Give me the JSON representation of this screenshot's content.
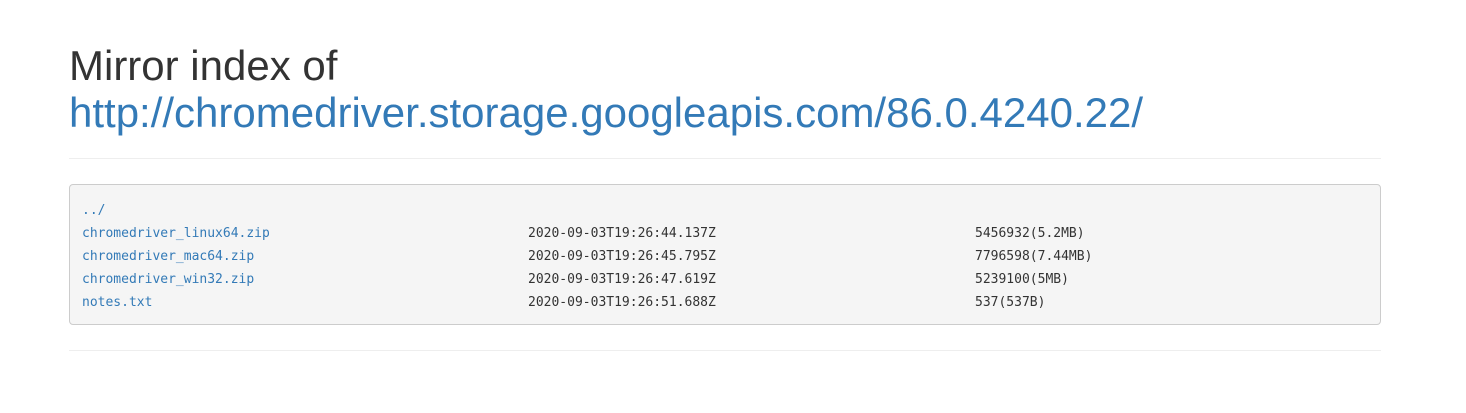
{
  "header": {
    "title_prefix": "Mirror index of",
    "title_url": "http://chromedriver.storage.googleapis.com/86.0.4240.22/"
  },
  "listing": {
    "parent_link": "../",
    "files": [
      {
        "name": "chromedriver_linux64.zip",
        "modified": "2020-09-03T19:26:44.137Z",
        "size": "5456932(5.2MB)"
      },
      {
        "name": "chromedriver_mac64.zip",
        "modified": "2020-09-03T19:26:45.795Z",
        "size": "7796598(7.44MB)"
      },
      {
        "name": "chromedriver_win32.zip",
        "modified": "2020-09-03T19:26:47.619Z",
        "size": "5239100(5MB)"
      },
      {
        "name": "notes.txt",
        "modified": "2020-09-03T19:26:51.688Z",
        "size": "537(537B)"
      }
    ]
  },
  "colors": {
    "link": "#337ab7",
    "text": "#333333",
    "listing_background": "#f5f5f5",
    "listing_border": "#cccccc"
  }
}
